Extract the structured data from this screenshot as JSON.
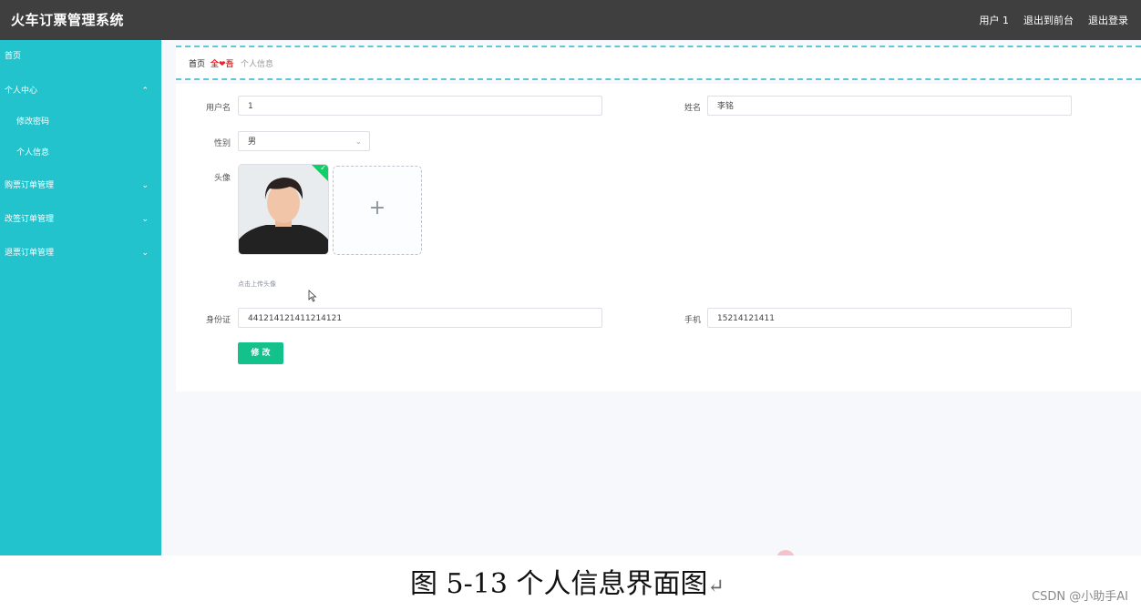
{
  "header": {
    "app_title": "火车订票管理系统",
    "user_label": "用户 1",
    "exit_front": "退出到前台",
    "logout": "退出登录"
  },
  "sidebar": {
    "items": [
      {
        "label": "首页",
        "level": 0
      },
      {
        "label": "个人中心",
        "level": 0,
        "chevron": "⌃"
      },
      {
        "label": "修改密码",
        "level": 1
      },
      {
        "label": "个人信息",
        "level": 1
      },
      {
        "label": "购票订单管理",
        "level": 0,
        "chevron": "⌄"
      },
      {
        "label": "改签订单管理",
        "level": 0,
        "chevron": "⌄"
      },
      {
        "label": "退票订单管理",
        "level": 0,
        "chevron": "⌄"
      }
    ]
  },
  "breadcrumb": {
    "home": "首页",
    "separator": "全❤吾",
    "current": "个人信息"
  },
  "form": {
    "username_label": "用户名",
    "username_value": "1",
    "name_label": "姓名",
    "name_value": "李铭",
    "gender_label": "性别",
    "gender_value": "男",
    "avatar_label": "头像",
    "upload_plus": "+",
    "upload_hint": "点击上传头像",
    "id_label": "身份证",
    "id_value": "441214121411214121",
    "phone_label": "手机",
    "phone_value": "15214121411",
    "submit_label": "修 改"
  },
  "caption": {
    "text": "图 5-13 个人信息界面图",
    "return_mark": "↵"
  },
  "watermark": "CSDN @小助手AI",
  "colors": {
    "topbar": "#3f3f3f",
    "sidebar": "#22c3cd",
    "accent_button": "#13c28a",
    "breadcrumb_border": "#5cc9d4"
  }
}
